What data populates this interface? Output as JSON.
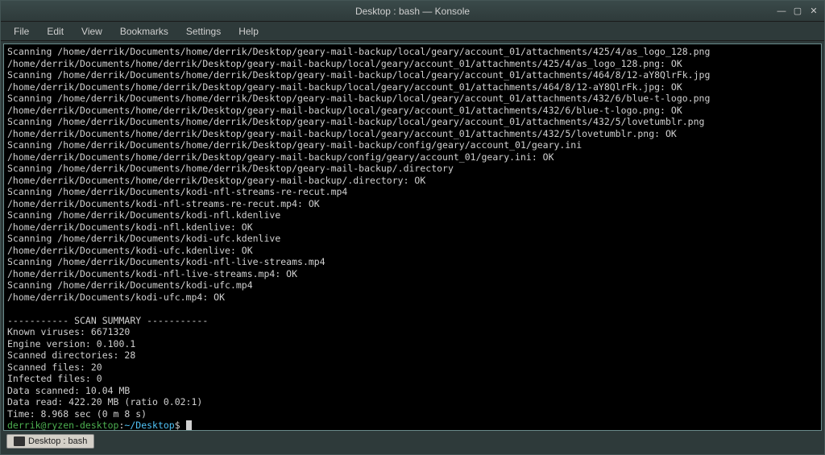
{
  "window": {
    "title": "Desktop : bash — Konsole"
  },
  "menu": {
    "file": "File",
    "edit": "Edit",
    "view": "View",
    "bookmarks": "Bookmarks",
    "settings": "Settings",
    "help": "Help"
  },
  "window_controls": {
    "minimize": "—",
    "maximize": "▢",
    "close": "✕"
  },
  "terminal": {
    "lines": [
      "Scanning /home/derrik/Documents/home/derrik/Desktop/geary-mail-backup/local/geary/account_01/attachments/425/4/as_logo_128.png",
      "/home/derrik/Documents/home/derrik/Desktop/geary-mail-backup/local/geary/account_01/attachments/425/4/as_logo_128.png: OK",
      "Scanning /home/derrik/Documents/home/derrik/Desktop/geary-mail-backup/local/geary/account_01/attachments/464/8/12-aY8QlrFk.jpg",
      "/home/derrik/Documents/home/derrik/Desktop/geary-mail-backup/local/geary/account_01/attachments/464/8/12-aY8QlrFk.jpg: OK",
      "Scanning /home/derrik/Documents/home/derrik/Desktop/geary-mail-backup/local/geary/account_01/attachments/432/6/blue-t-logo.png",
      "/home/derrik/Documents/home/derrik/Desktop/geary-mail-backup/local/geary/account_01/attachments/432/6/blue-t-logo.png: OK",
      "Scanning /home/derrik/Documents/home/derrik/Desktop/geary-mail-backup/local/geary/account_01/attachments/432/5/lovetumblr.png",
      "/home/derrik/Documents/home/derrik/Desktop/geary-mail-backup/local/geary/account_01/attachments/432/5/lovetumblr.png: OK",
      "Scanning /home/derrik/Documents/home/derrik/Desktop/geary-mail-backup/config/geary/account_01/geary.ini",
      "/home/derrik/Documents/home/derrik/Desktop/geary-mail-backup/config/geary/account_01/geary.ini: OK",
      "Scanning /home/derrik/Documents/home/derrik/Desktop/geary-mail-backup/.directory",
      "/home/derrik/Documents/home/derrik/Desktop/geary-mail-backup/.directory: OK",
      "Scanning /home/derrik/Documents/kodi-nfl-streams-re-recut.mp4",
      "/home/derrik/Documents/kodi-nfl-streams-re-recut.mp4: OK",
      "Scanning /home/derrik/Documents/kodi-nfl.kdenlive",
      "/home/derrik/Documents/kodi-nfl.kdenlive: OK",
      "Scanning /home/derrik/Documents/kodi-ufc.kdenlive",
      "/home/derrik/Documents/kodi-ufc.kdenlive: OK",
      "Scanning /home/derrik/Documents/kodi-nfl-live-streams.mp4",
      "/home/derrik/Documents/kodi-nfl-live-streams.mp4: OK",
      "Scanning /home/derrik/Documents/kodi-ufc.mp4",
      "/home/derrik/Documents/kodi-ufc.mp4: OK",
      "",
      "----------- SCAN SUMMARY -----------",
      "Known viruses: 6671320",
      "Engine version: 0.100.1",
      "Scanned directories: 28",
      "Scanned files: 20",
      "Infected files: 0",
      "Data scanned: 10.04 MB",
      "Data read: 422.20 MB (ratio 0.02:1)",
      "Time: 8.968 sec (0 m 8 s)"
    ],
    "prompt": {
      "user_host": "derrik@ryzen-desktop",
      "sep": ":",
      "path": "~/Desktop",
      "dollar": "$ "
    }
  },
  "tab": {
    "label": "Desktop : bash"
  }
}
